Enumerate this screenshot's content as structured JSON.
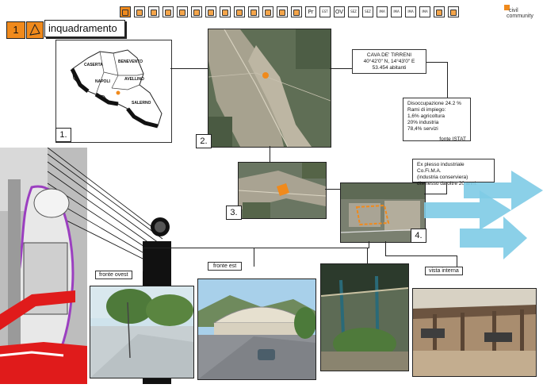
{
  "header": {
    "section_number": "1",
    "section_title": "inquadramento",
    "brand_line1": "civil",
    "brand_line2": "community"
  },
  "toolbar": {
    "icons": [
      {
        "name": "overview-icon",
        "text": ""
      },
      {
        "name": "layers-icon",
        "text": ""
      },
      {
        "name": "chart-icon",
        "text": ""
      },
      {
        "name": "walk-icon",
        "text": ""
      },
      {
        "name": "tool-icon",
        "text": ""
      },
      {
        "name": "network-icon",
        "text": ""
      },
      {
        "name": "person-icon",
        "text": ""
      },
      {
        "name": "sun-icon",
        "text": ""
      },
      {
        "name": "folder-icon",
        "text": ""
      },
      {
        "name": "crane-icon",
        "text": ""
      },
      {
        "name": "stairs-icon",
        "text": ""
      },
      {
        "name": "grid-icon",
        "text": ""
      },
      {
        "name": "leaf-icon",
        "text": ""
      },
      {
        "name": "pr-icon",
        "text": "Pr"
      },
      {
        "name": "est-icon",
        "text": "EST"
      },
      {
        "name": "ovest-icon",
        "text": "OV"
      },
      {
        "name": "sez-icon",
        "text": "SEZ"
      },
      {
        "name": "sez-alt-icon",
        "text": "SEZ"
      },
      {
        "name": "ima1-icon",
        "text": "IMA"
      },
      {
        "name": "ima2-icon",
        "text": "IMA"
      },
      {
        "name": "ima3-icon",
        "text": "IMA"
      },
      {
        "name": "ima4-icon",
        "text": "IMA"
      },
      {
        "name": "plan-icon",
        "text": ""
      },
      {
        "name": "book-icon",
        "text": ""
      }
    ]
  },
  "map": {
    "number": "1.",
    "regions": [
      "CASERTA",
      "BENEVENTO",
      "NAPOLI",
      "AVELLINO",
      "SALERNO"
    ]
  },
  "satellite": {
    "n2": "2.",
    "n3": "3.",
    "n4": "4."
  },
  "town_info": {
    "name": "CAVA DE' TIRRENI",
    "coords": "40°42'0\" N, 14°43'0\" E",
    "population": "53.454 abitanti"
  },
  "stats": {
    "line1": "Disoccupazione 24.2 %",
    "line2": "Rami di impiego:",
    "line3": "1,6% agricoltura",
    "line4": "20% industria",
    "line5": "78,4% servizi",
    "source": "fonte ISTAT"
  },
  "site_info": {
    "line1": "Ex plesso industriale Co.Fi.M.A.",
    "line2": "(industria conserviera)",
    "line3": "dismesso da oltre 20 anni."
  },
  "photos": {
    "west": "fronte ovest",
    "east": "fronte est",
    "interior": "vista interna"
  },
  "colors": {
    "accent_orange": "#f08a1c",
    "arrow_blue": "#7ecbe6",
    "red": "#e01b1b",
    "purple": "#9b3fc0"
  }
}
